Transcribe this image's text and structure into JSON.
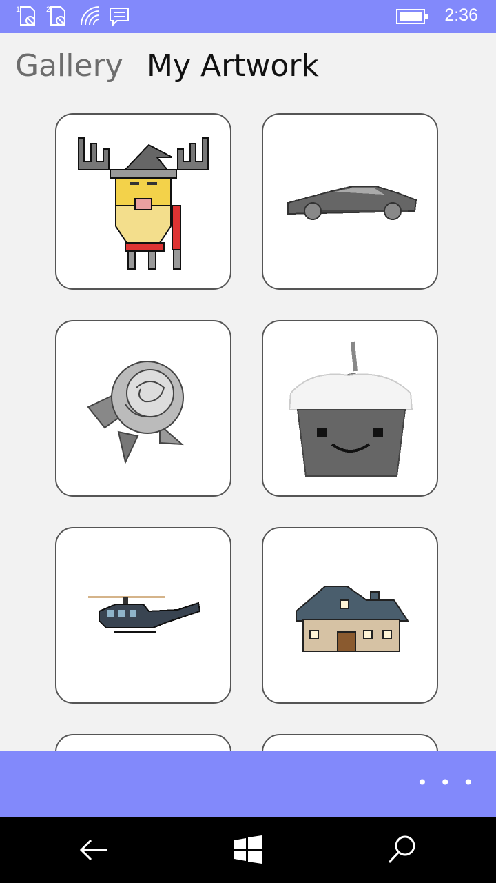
{
  "status_bar": {
    "time": "2:36",
    "icons": [
      "sim1-no-signal-icon",
      "sim2-no-signal-icon",
      "wifi-icon",
      "message-icon",
      "battery-icon"
    ],
    "color": "#8289fb"
  },
  "pivot": {
    "tabs": [
      {
        "label": "Gallery",
        "active": false
      },
      {
        "label": "My Artwork",
        "active": true
      }
    ]
  },
  "artworks": [
    {
      "icon": "moose-gnome-icon"
    },
    {
      "icon": "sports-car-icon"
    },
    {
      "icon": "rose-icon"
    },
    {
      "icon": "cupcake-icon"
    },
    {
      "icon": "helicopter-icon"
    },
    {
      "icon": "house-icon"
    },
    {
      "icon": "artwork-partial"
    },
    {
      "icon": "artwork-partial"
    }
  ],
  "app_bar": {
    "more_label": "• • •",
    "color": "#8289fb"
  },
  "nav_bar": {
    "icons": [
      "back-icon",
      "windows-icon",
      "search-icon"
    ]
  }
}
